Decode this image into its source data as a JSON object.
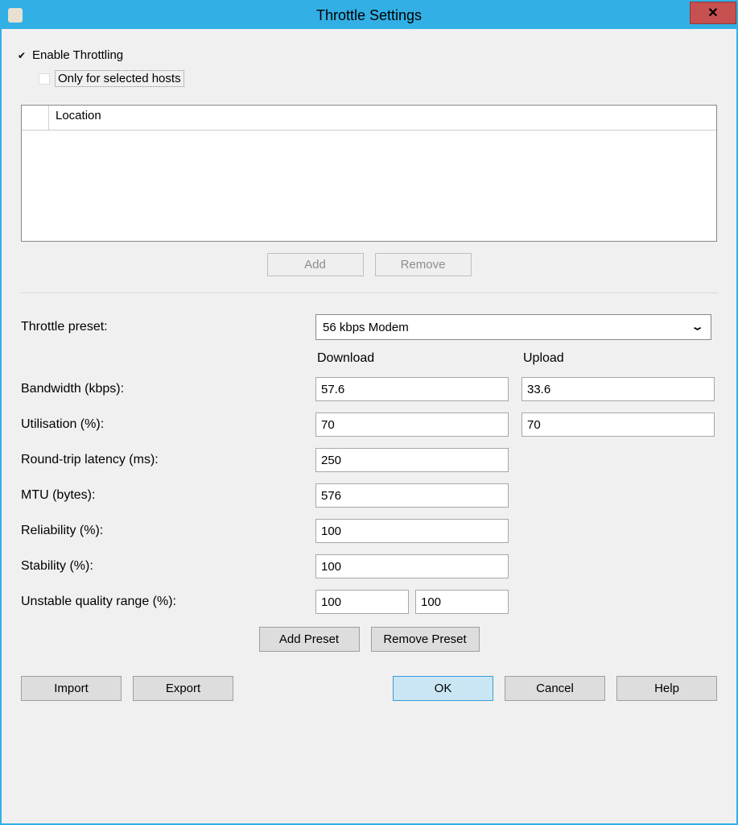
{
  "window": {
    "title": "Throttle Settings",
    "close_symbol": "✕"
  },
  "checkboxes": {
    "enable_label": "Enable Throttling",
    "only_selected_label": "Only for selected hosts"
  },
  "hosts": {
    "column_location": "Location",
    "add_label": "Add",
    "remove_label": "Remove"
  },
  "preset": {
    "label": "Throttle preset:",
    "selected": "56 kbps Modem"
  },
  "columns": {
    "download": "Download",
    "upload": "Upload"
  },
  "fields": {
    "bandwidth": {
      "label": "Bandwidth (kbps):",
      "download": "57.6",
      "upload": "33.6"
    },
    "utilisation": {
      "label": "Utilisation (%):",
      "download": "70",
      "upload": "70"
    },
    "latency": {
      "label": "Round-trip latency (ms):",
      "value": "250"
    },
    "mtu": {
      "label": "MTU (bytes):",
      "value": "576"
    },
    "reliability": {
      "label": "Reliability (%):",
      "value": "100"
    },
    "stability": {
      "label": "Stability (%):",
      "value": "100"
    },
    "unstable": {
      "label": "Unstable quality range (%):",
      "low": "100",
      "high": "100"
    }
  },
  "preset_buttons": {
    "add": "Add Preset",
    "remove": "Remove Preset"
  },
  "bottom": {
    "import": "Import",
    "export": "Export",
    "ok": "OK",
    "cancel": "Cancel",
    "help": "Help"
  }
}
